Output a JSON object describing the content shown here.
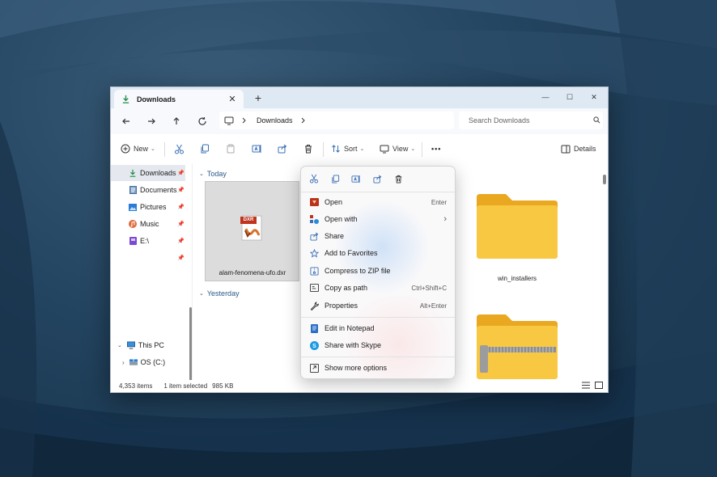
{
  "window": {
    "tab_title": "Downloads",
    "tab_close": "✕",
    "new_tab": "+",
    "controls": {
      "minimize": "—",
      "maximize": "☐",
      "close": "✕"
    }
  },
  "address": {
    "path": [
      "Downloads"
    ],
    "search_placeholder": "Search Downloads"
  },
  "toolbar": {
    "new_label": "New",
    "sort_label": "Sort",
    "view_label": "View",
    "more_label": "•••",
    "details_label": "Details"
  },
  "sidebar": {
    "items": [
      {
        "label": "Downloads",
        "icon": "download-icon"
      },
      {
        "label": "Documents",
        "icon": "document-icon"
      },
      {
        "label": "Pictures",
        "icon": "pictures-icon"
      },
      {
        "label": "Music",
        "icon": "music-icon"
      },
      {
        "label": "E:\\",
        "icon": "drive-icon"
      }
    ],
    "this_pc": "This PC",
    "os_drive": "OS (C:)"
  },
  "content": {
    "group_today": "Today",
    "group_yesterday": "Yesterday",
    "files": [
      {
        "name": "alam-fenomena-ufo.dxr",
        "badge": "DXR"
      },
      {
        "name": "win_installers"
      }
    ]
  },
  "status": {
    "count": "4,353 items",
    "selection": "1 item selected",
    "size": "985 KB"
  },
  "context_menu": {
    "items": [
      {
        "label": "Open",
        "shortcut": "Enter",
        "icon": "open-app-icon"
      },
      {
        "label": "Open with",
        "shortcut": "›",
        "icon": "open-with-icon"
      },
      {
        "label": "Share",
        "shortcut": "",
        "icon": "share-icon"
      },
      {
        "label": "Add to Favorites",
        "shortcut": "",
        "icon": "star-icon"
      },
      {
        "label": "Compress to ZIP file",
        "shortcut": "",
        "icon": "zip-icon"
      },
      {
        "label": "Copy as path",
        "shortcut": "Ctrl+Shift+C",
        "icon": "copy-path-icon"
      },
      {
        "label": "Properties",
        "shortcut": "Alt+Enter",
        "icon": "wrench-icon"
      },
      {
        "label": "Edit in Notepad",
        "shortcut": "",
        "icon": "notepad-icon"
      },
      {
        "label": "Share with Skype",
        "shortcut": "",
        "icon": "skype-icon"
      },
      {
        "label": "Show more options",
        "shortcut": "",
        "icon": "more-options-icon"
      }
    ]
  },
  "colors": {
    "accent": "#0067c0",
    "folder": "#f8c843",
    "folder_dark": "#e9a820"
  }
}
